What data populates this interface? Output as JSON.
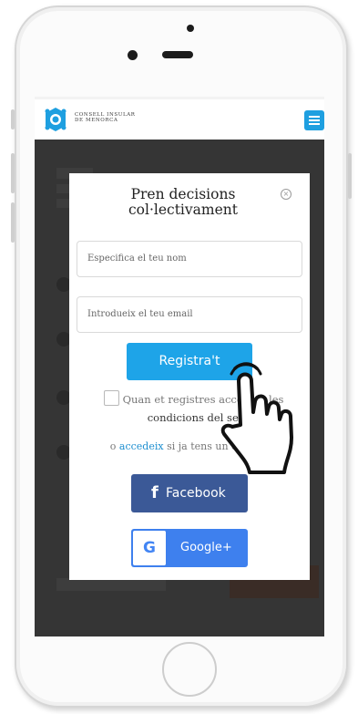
{
  "site": {
    "org_line1": "CONSELL INSULAR",
    "org_line2": "DE MENORCA"
  },
  "modal": {
    "title": "Pren decisions col·lectivament",
    "name_placeholder": "Especifica el teu nom",
    "email_placeholder": "Introdueix el teu email",
    "register_label": "Registra't",
    "terms_part1": "Quan et registres acceptes les",
    "terms_part2": "condicions del servei",
    "login_prefix": "o",
    "login_link": "accedeix",
    "login_suffix": "si ja tens un compte",
    "facebook_label": "Facebook",
    "facebook_glyph": "f",
    "google_label": "Google+",
    "google_glyph": "G",
    "close_glyph": "×"
  },
  "icons": {
    "close": "close-icon",
    "menu": "hamburger-menu-icon",
    "pointer": "hand-pointer-icon",
    "logo": "consell-logo-icon"
  },
  "colors": {
    "accent": "#1ea4e8",
    "facebook": "#3b5997",
    "google": "#3e80ee",
    "link": "#1e8fd0",
    "overlay": "#353535"
  }
}
